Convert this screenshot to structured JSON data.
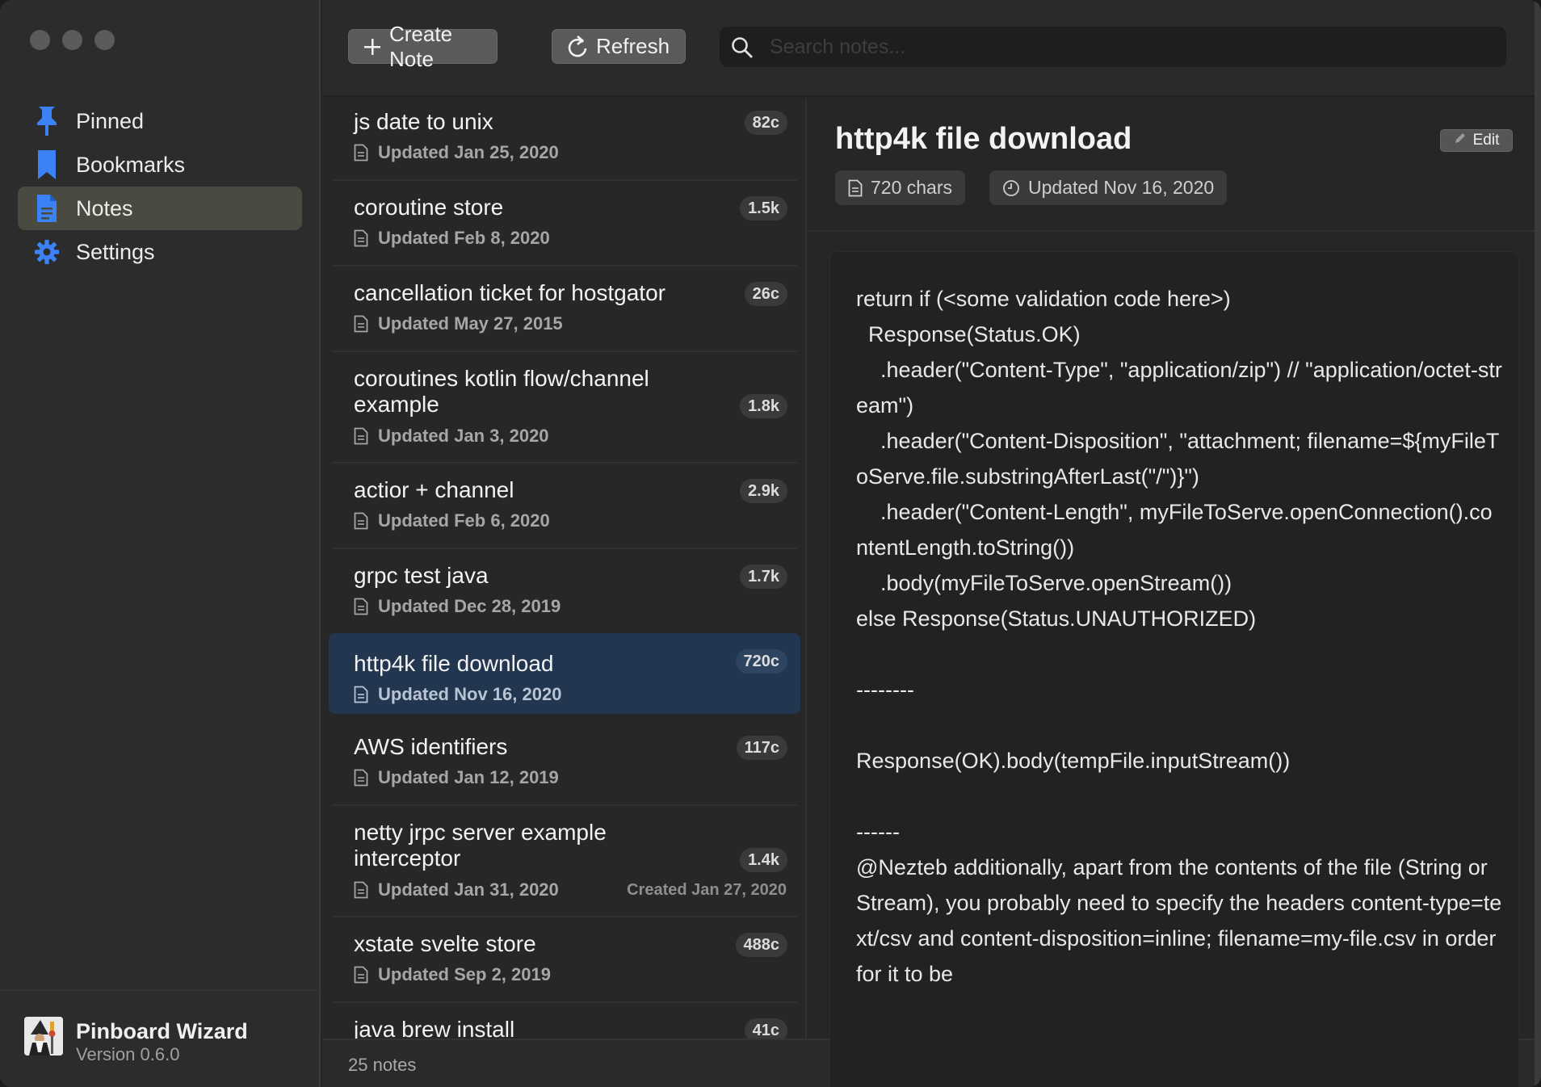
{
  "sidebar": {
    "items": [
      {
        "label": "Pinned",
        "icon": "pin-icon"
      },
      {
        "label": "Bookmarks",
        "icon": "bookmark-icon"
      },
      {
        "label": "Notes",
        "icon": "document-icon",
        "active": true
      },
      {
        "label": "Settings",
        "icon": "gear-icon"
      }
    ],
    "app_name": "Pinboard Wizard",
    "version": "Version 0.6.0"
  },
  "toolbar": {
    "create_label": "Create Note",
    "refresh_label": "Refresh",
    "search_placeholder": "Search notes..."
  },
  "notes": [
    {
      "title": "js date to unix",
      "updated": "Updated Jan 25, 2020",
      "size": "82c"
    },
    {
      "title": "coroutine store",
      "updated": "Updated Feb 8, 2020",
      "size": "1.5k"
    },
    {
      "title": "cancellation ticket for hostgator",
      "updated": "Updated May 27, 2015",
      "size": "26c"
    },
    {
      "title": "coroutines kotlin flow/channel example",
      "updated": "Updated Jan 3, 2020",
      "size": "1.8k"
    },
    {
      "title": "actior + channel",
      "updated": "Updated Feb 6, 2020",
      "size": "2.9k"
    },
    {
      "title": "grpc test java",
      "updated": "Updated Dec 28, 2019",
      "size": "1.7k"
    },
    {
      "title": "http4k file download",
      "updated": "Updated Nov 16, 2020",
      "size": "720c",
      "selected": true
    },
    {
      "title": "AWS identifiers",
      "updated": "Updated Jan 12, 2019",
      "size": "117c"
    },
    {
      "title": "netty jrpc server example interceptor",
      "updated": "Updated Jan 31, 2020",
      "created": "Created Jan 27, 2020",
      "size": "1.4k"
    },
    {
      "title": "xstate svelte store",
      "updated": "Updated Sep 2, 2019",
      "size": "488c"
    },
    {
      "title": "java brew install",
      "updated": "",
      "size": "41c"
    }
  ],
  "footer": {
    "count": "25 notes"
  },
  "detail": {
    "title": "http4k file download",
    "edit_label": "Edit",
    "chars": "720 chars",
    "updated": "Updated Nov 16, 2020",
    "body": "return if (<some validation code here>)\n  Response(Status.OK)\n    .header(\"Content-Type\", \"application/zip\") // \"application/octet-stream\")\n    .header(\"Content-Disposition\", \"attachment; filename=${myFileToServe.file.substringAfterLast(\"/\")}\")\n    .header(\"Content-Length\", myFileToServe.openConnection().contentLength.toString())\n    .body(myFileToServe.openStream())\nelse Response(Status.UNAUTHORIZED)\n\n--------\n\nResponse(OK).body(tempFile.inputStream())\n\n------\n@Nezteb additionally, apart from the contents of the file (String or Stream), you probably need to specify the headers content-type=text/csv and content-disposition=inline; filename=my-file.csv in order for it to be"
  },
  "colors": {
    "accent": "#3b82f6",
    "selected_row": "#223650",
    "active_nav": "#4a4a40"
  }
}
